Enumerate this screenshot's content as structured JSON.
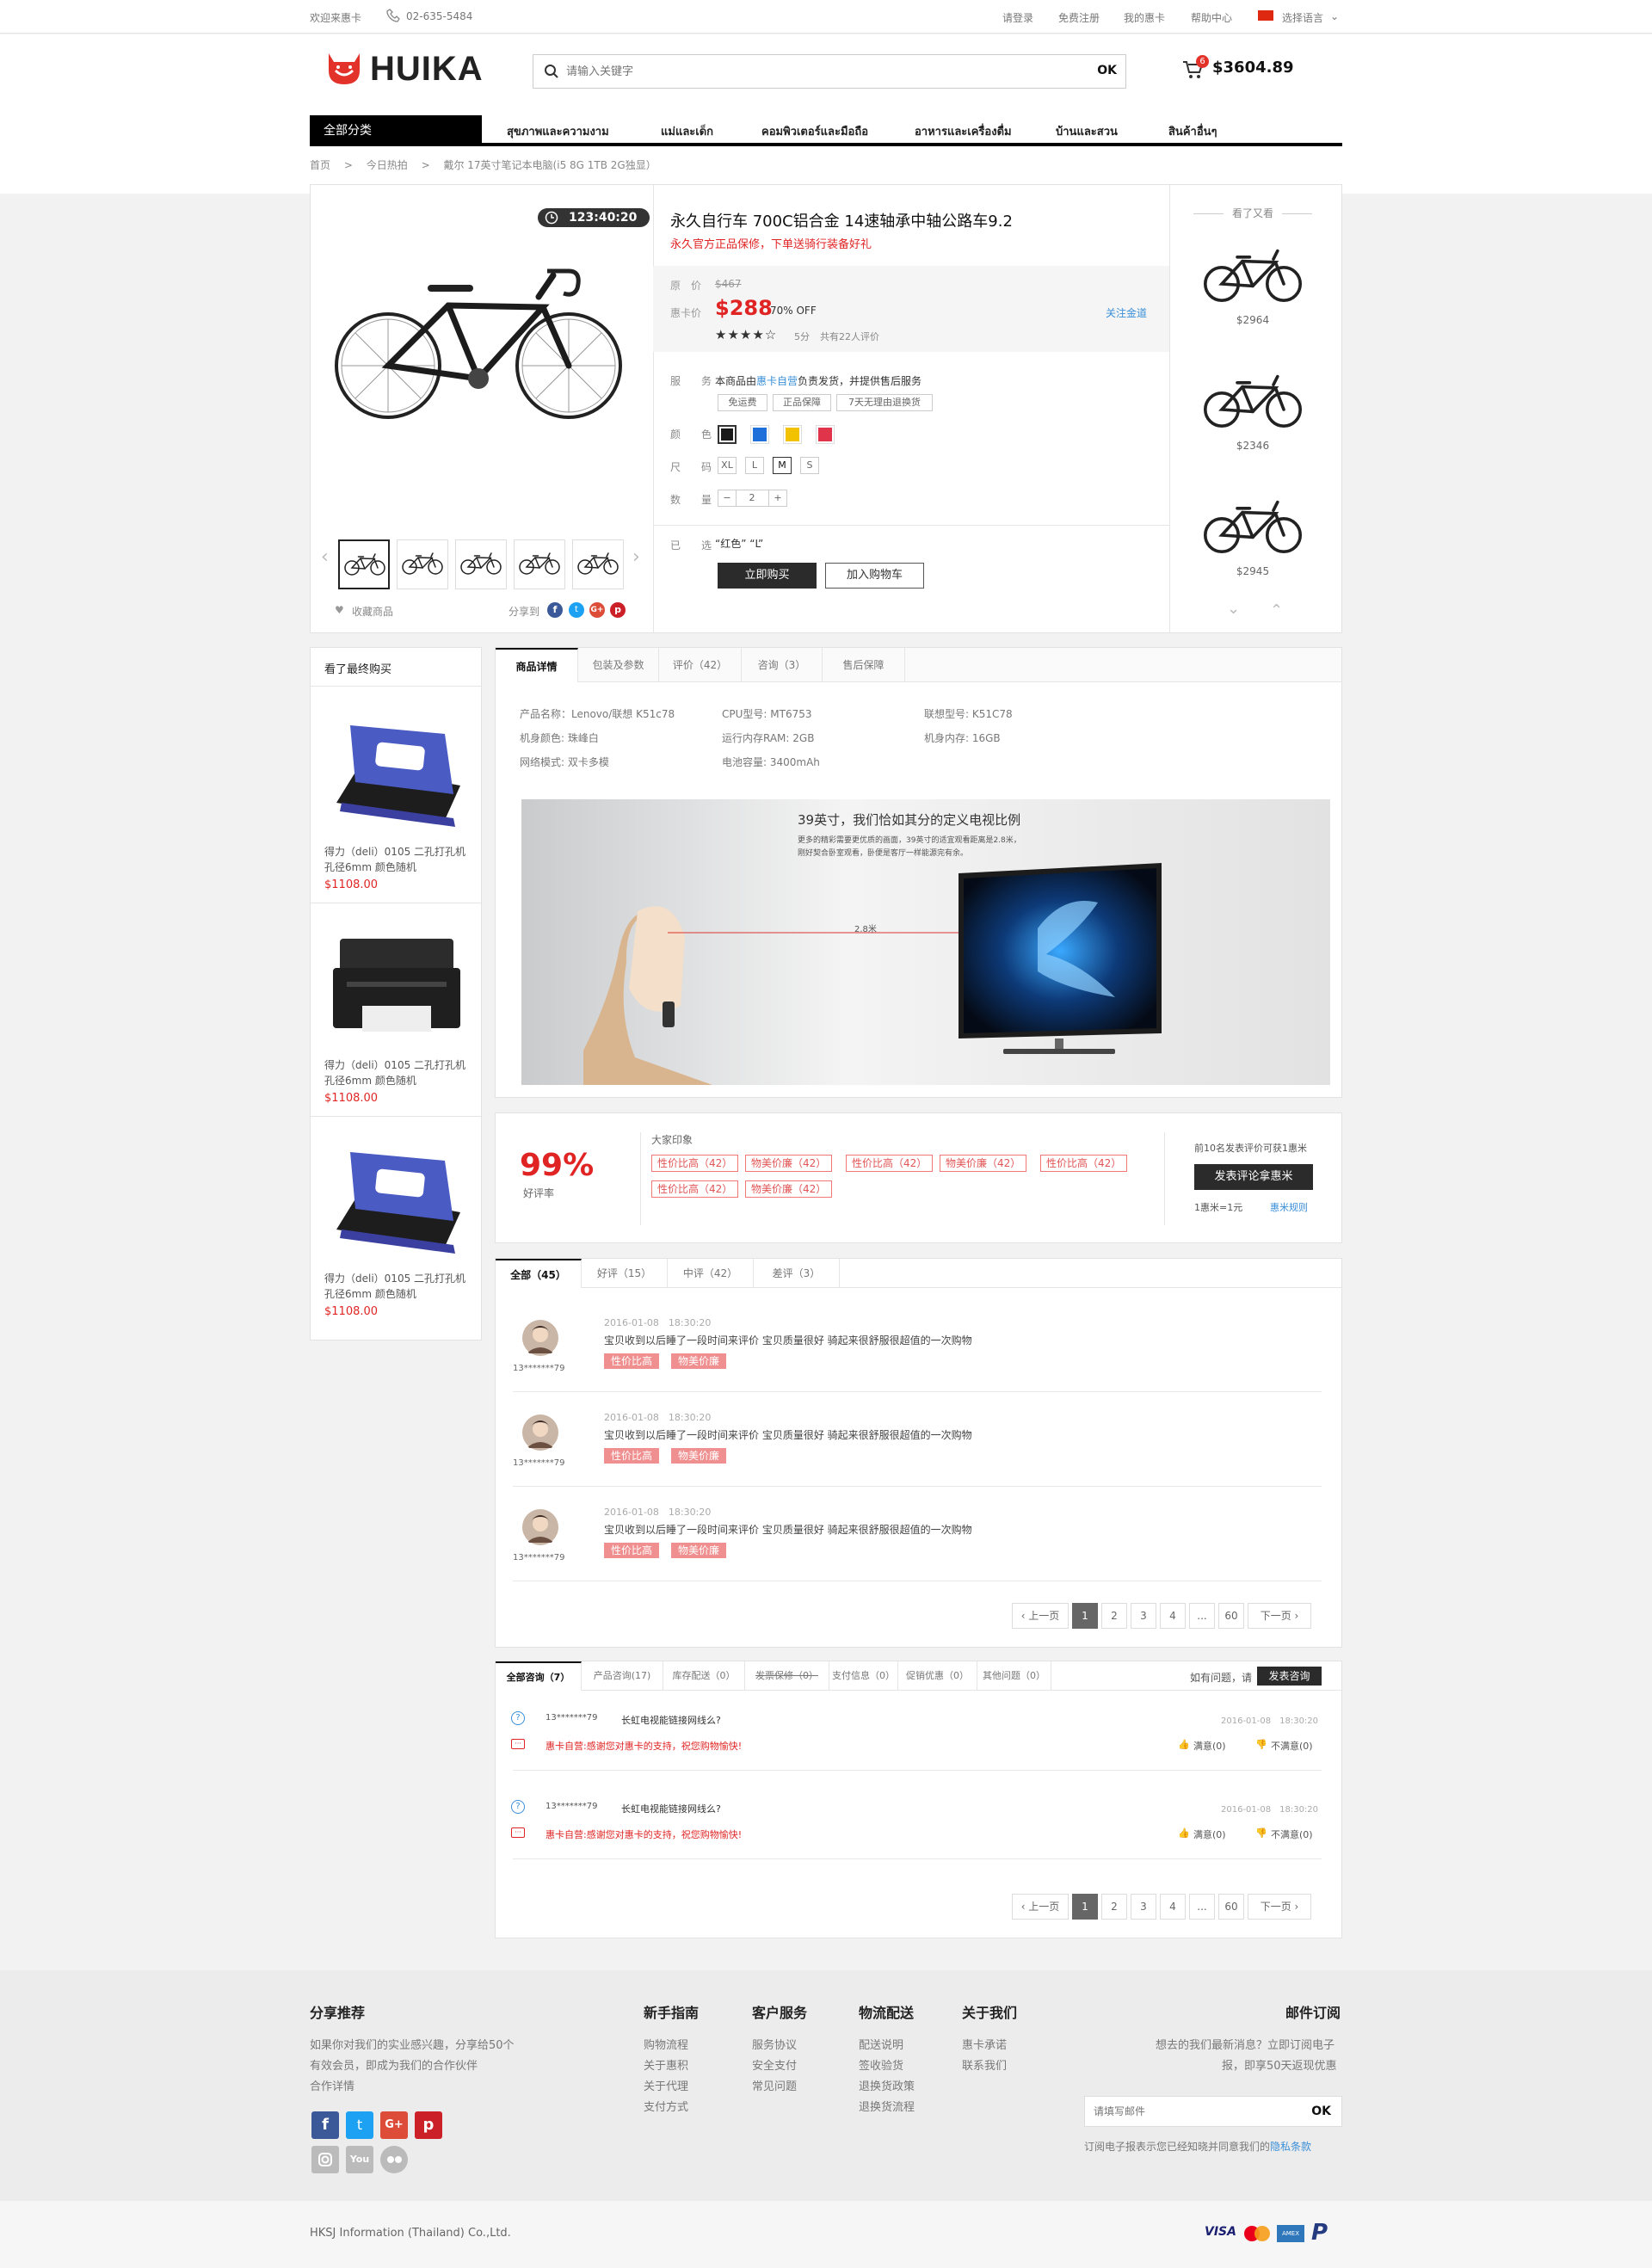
{
  "topbar": {
    "welcome": "欢迎来惠卡",
    "phone": "02-635-5484",
    "login": "请登录",
    "register": "免费注册",
    "my": "我的惠卡",
    "help": "帮助中心",
    "lang": "选择语言"
  },
  "header": {
    "logo": "HUIKA",
    "search_placeholder": "请输入关键字",
    "search_btn": "OK",
    "cart_count": "6",
    "cart_total": "$3604.89"
  },
  "nav": {
    "all": "全部分类",
    "items": [
      "สุขภาพและความงาม",
      "แม่และเด็ก",
      "คอมพิวเตอร์และมือถือ",
      "อาหารและเครื่องดื่ม",
      "บ้านและสวน",
      "สินค้าอื่นๆ"
    ]
  },
  "breadcrumb": {
    "home": "首页",
    "sep1": ">",
    "cat": "今日热拍",
    "sep2": ">",
    "item": "戴尔 17英寸笔记本电脑(i5 8G 1TB 2G独显）"
  },
  "product": {
    "countdown": "123:40:20",
    "title": "永久自行车 700C铝合金 14速轴承中轴公路车9.2",
    "subtitle": "永久官方正品保修，下单送骑行装备好礼",
    "orig_label": "原　价",
    "orig_price": "$467",
    "card_label": "惠卡价",
    "price": "$288",
    "discount": "70% OFF",
    "follow": "关注金道",
    "score": "5分",
    "reviews": "共有22人评价",
    "service_label": "服　务",
    "service_text_a": "本商品由",
    "service_link": "惠卡自营",
    "service_text_b": "负责发货，并提供售后服务",
    "service_tags": [
      "免运费",
      "正品保障",
      "7天无理由退换货"
    ],
    "color_label": "颜　色",
    "colors": [
      "#1a1a1a",
      "#1e6fd9",
      "#f2c200",
      "#e0344b"
    ],
    "size_label": "尺　码",
    "sizes": [
      "XL",
      "L",
      "M",
      "S"
    ],
    "qty_label": "数　量",
    "qty_minus": "−",
    "qty": "2",
    "qty_plus": "+",
    "chosen_label": "已　选",
    "chosen": "“红色” “L”",
    "buy_btn": "立即购买",
    "cart_btn": "加入购物车",
    "fav": "收藏商品",
    "share": "分享到"
  },
  "viewed": {
    "title": "看了又看",
    "prices": [
      "$2964",
      "$2346",
      "$2945"
    ]
  },
  "sidebar": {
    "title": "看了最终购买",
    "items": [
      {
        "name": "得力（deli）0105 二孔打孔机孔径6mm 颜色随机",
        "price": "$1108.00"
      },
      {
        "name": "得力（deli）0105 二孔打孔机孔径6mm 颜色随机",
        "price": "$1108.00"
      },
      {
        "name": "得力（deli）0105 二孔打孔机孔径6mm 颜色随机",
        "price": "$1108.00"
      }
    ]
  },
  "detail": {
    "tabs": [
      "商品详情",
      "包装及参数",
      "评价（42）",
      "咨询（3）",
      "售后保障"
    ],
    "specs": [
      "产品名称：Lenovo/联想 K51c78",
      "CPU型号: MT6753",
      "联想型号: K51C78",
      "机身颜色: 珠峰白",
      "运行内存RAM: 2GB",
      "机身内存: 16GB",
      "网络模式: 双卡多模",
      "电池容量: 3400mAh"
    ],
    "banner_title": "39英寸，我们恰如其分的定义电视比例",
    "banner_sub1": "更多的精彩需要更优质的画面，39英寸的适宜观看距离是2.8米，",
    "banner_sub2": "刚好契合卧室观看，卧便是客厅一样能源完有余。",
    "banner_dist": "2.8米"
  },
  "rating": {
    "pct": "99%",
    "label": "好评率",
    "impress": "大家印象",
    "tags": [
      "性价比高（42）",
      "物美价廉（42）",
      "性价比高（42）",
      "物美价廉（42）",
      "性价比高（42）",
      "性价比高（42）",
      "物美价廉（42）"
    ],
    "top10": "前10名发表评价可获1惠米",
    "post_btn": "发表评论拿惠米",
    "rate": "1惠米=1元",
    "rule": "惠米规则"
  },
  "reviews": {
    "tabs": [
      "全部（45）",
      "好评（15）",
      "中评（42）",
      "差评（3）"
    ],
    "items": [
      {
        "date": "2016-01-08　18:30:20",
        "user": "13*******79",
        "text": "宝贝收到以后睡了一段时间来评价 宝贝质量很好 骑起来很舒服很超值的一次购物",
        "tags": [
          "性价比高",
          "物美价廉"
        ]
      },
      {
        "date": "2016-01-08　18:30:20",
        "user": "13*******79",
        "text": "宝贝收到以后睡了一段时间来评价 宝贝质量很好 骑起来很舒服很超值的一次购物",
        "tags": [
          "性价比高",
          "物美价廉"
        ]
      },
      {
        "date": "2016-01-08　18:30:20",
        "user": "13*******79",
        "text": "宝贝收到以后睡了一段时间来评价 宝贝质量很好 骑起来很舒服很超值的一次购物",
        "tags": [
          "性价比高",
          "物美价廉"
        ]
      }
    ],
    "pager": {
      "prev": "上一页",
      "pages": [
        "1",
        "2",
        "3",
        "4",
        "...",
        "60"
      ],
      "next": "下一页"
    }
  },
  "qa": {
    "tabs": [
      "全部咨询（7）",
      "产品咨询(17)",
      "库存配送（0）",
      "发票保修（0）",
      "支付信息（0）",
      "促销优惠（0）",
      "其他问题（0）"
    ],
    "ask_text": "如有问题，请",
    "ask_btn": "发表咨询",
    "items": [
      {
        "user": "13*******79",
        "q": "长虹电视能链接网线么?",
        "date": "2016-01-08　18:30:20",
        "a": "惠卡自营:感谢您对惠卡的支持，祝您购物愉快!",
        "useful": "满意(0)",
        "useless": "不满意(0)"
      },
      {
        "user": "13*******79",
        "q": "长虹电视能链接网线么?",
        "date": "2016-01-08　18:30:20",
        "a": "惠卡自营:感谢您对惠卡的支持，祝您购物愉快!",
        "useful": "满意(0)",
        "useless": "不满意(0)"
      }
    ],
    "pager": {
      "prev": "上一页",
      "pages": [
        "1",
        "2",
        "3",
        "4",
        "...",
        "60"
      ],
      "next": "下一页"
    }
  },
  "footer": {
    "share_title": "分享推荐",
    "share_text": [
      "如果你对我们的实业感兴趣，分享给50个",
      "有效会员，即成为我们的合作伙伴",
      "合作详情"
    ],
    "cols": [
      {
        "title": "新手指南",
        "links": [
          "购物流程",
          "关于惠积",
          "关于代理",
          "支付方式"
        ]
      },
      {
        "title": "客户服务",
        "links": [
          "服务协议",
          "安全支付",
          "常见问题"
        ]
      },
      {
        "title": "物流配送",
        "links": [
          "配送说明",
          "签收验货",
          "退换货政策",
          "退换货流程"
        ]
      },
      {
        "title": "关于我们",
        "links": [
          "惠卡承诺",
          "联系我们"
        ]
      }
    ],
    "mail_title": "邮件订阅",
    "mail_text1": "想去的我们最新消息？立即订阅电子",
    "mail_text2": "报，即享50天返现优惠",
    "mail_placeholder": "请填写邮件",
    "mail_btn": "OK",
    "mail_note": "订阅电子报表示您已经知晓并同意我们的",
    "mail_link": "隐私条款",
    "copyright": "HKSJ Information (Thailand) Co.,Ltd.",
    "payments": [
      "VISA",
      "PayPal"
    ]
  }
}
